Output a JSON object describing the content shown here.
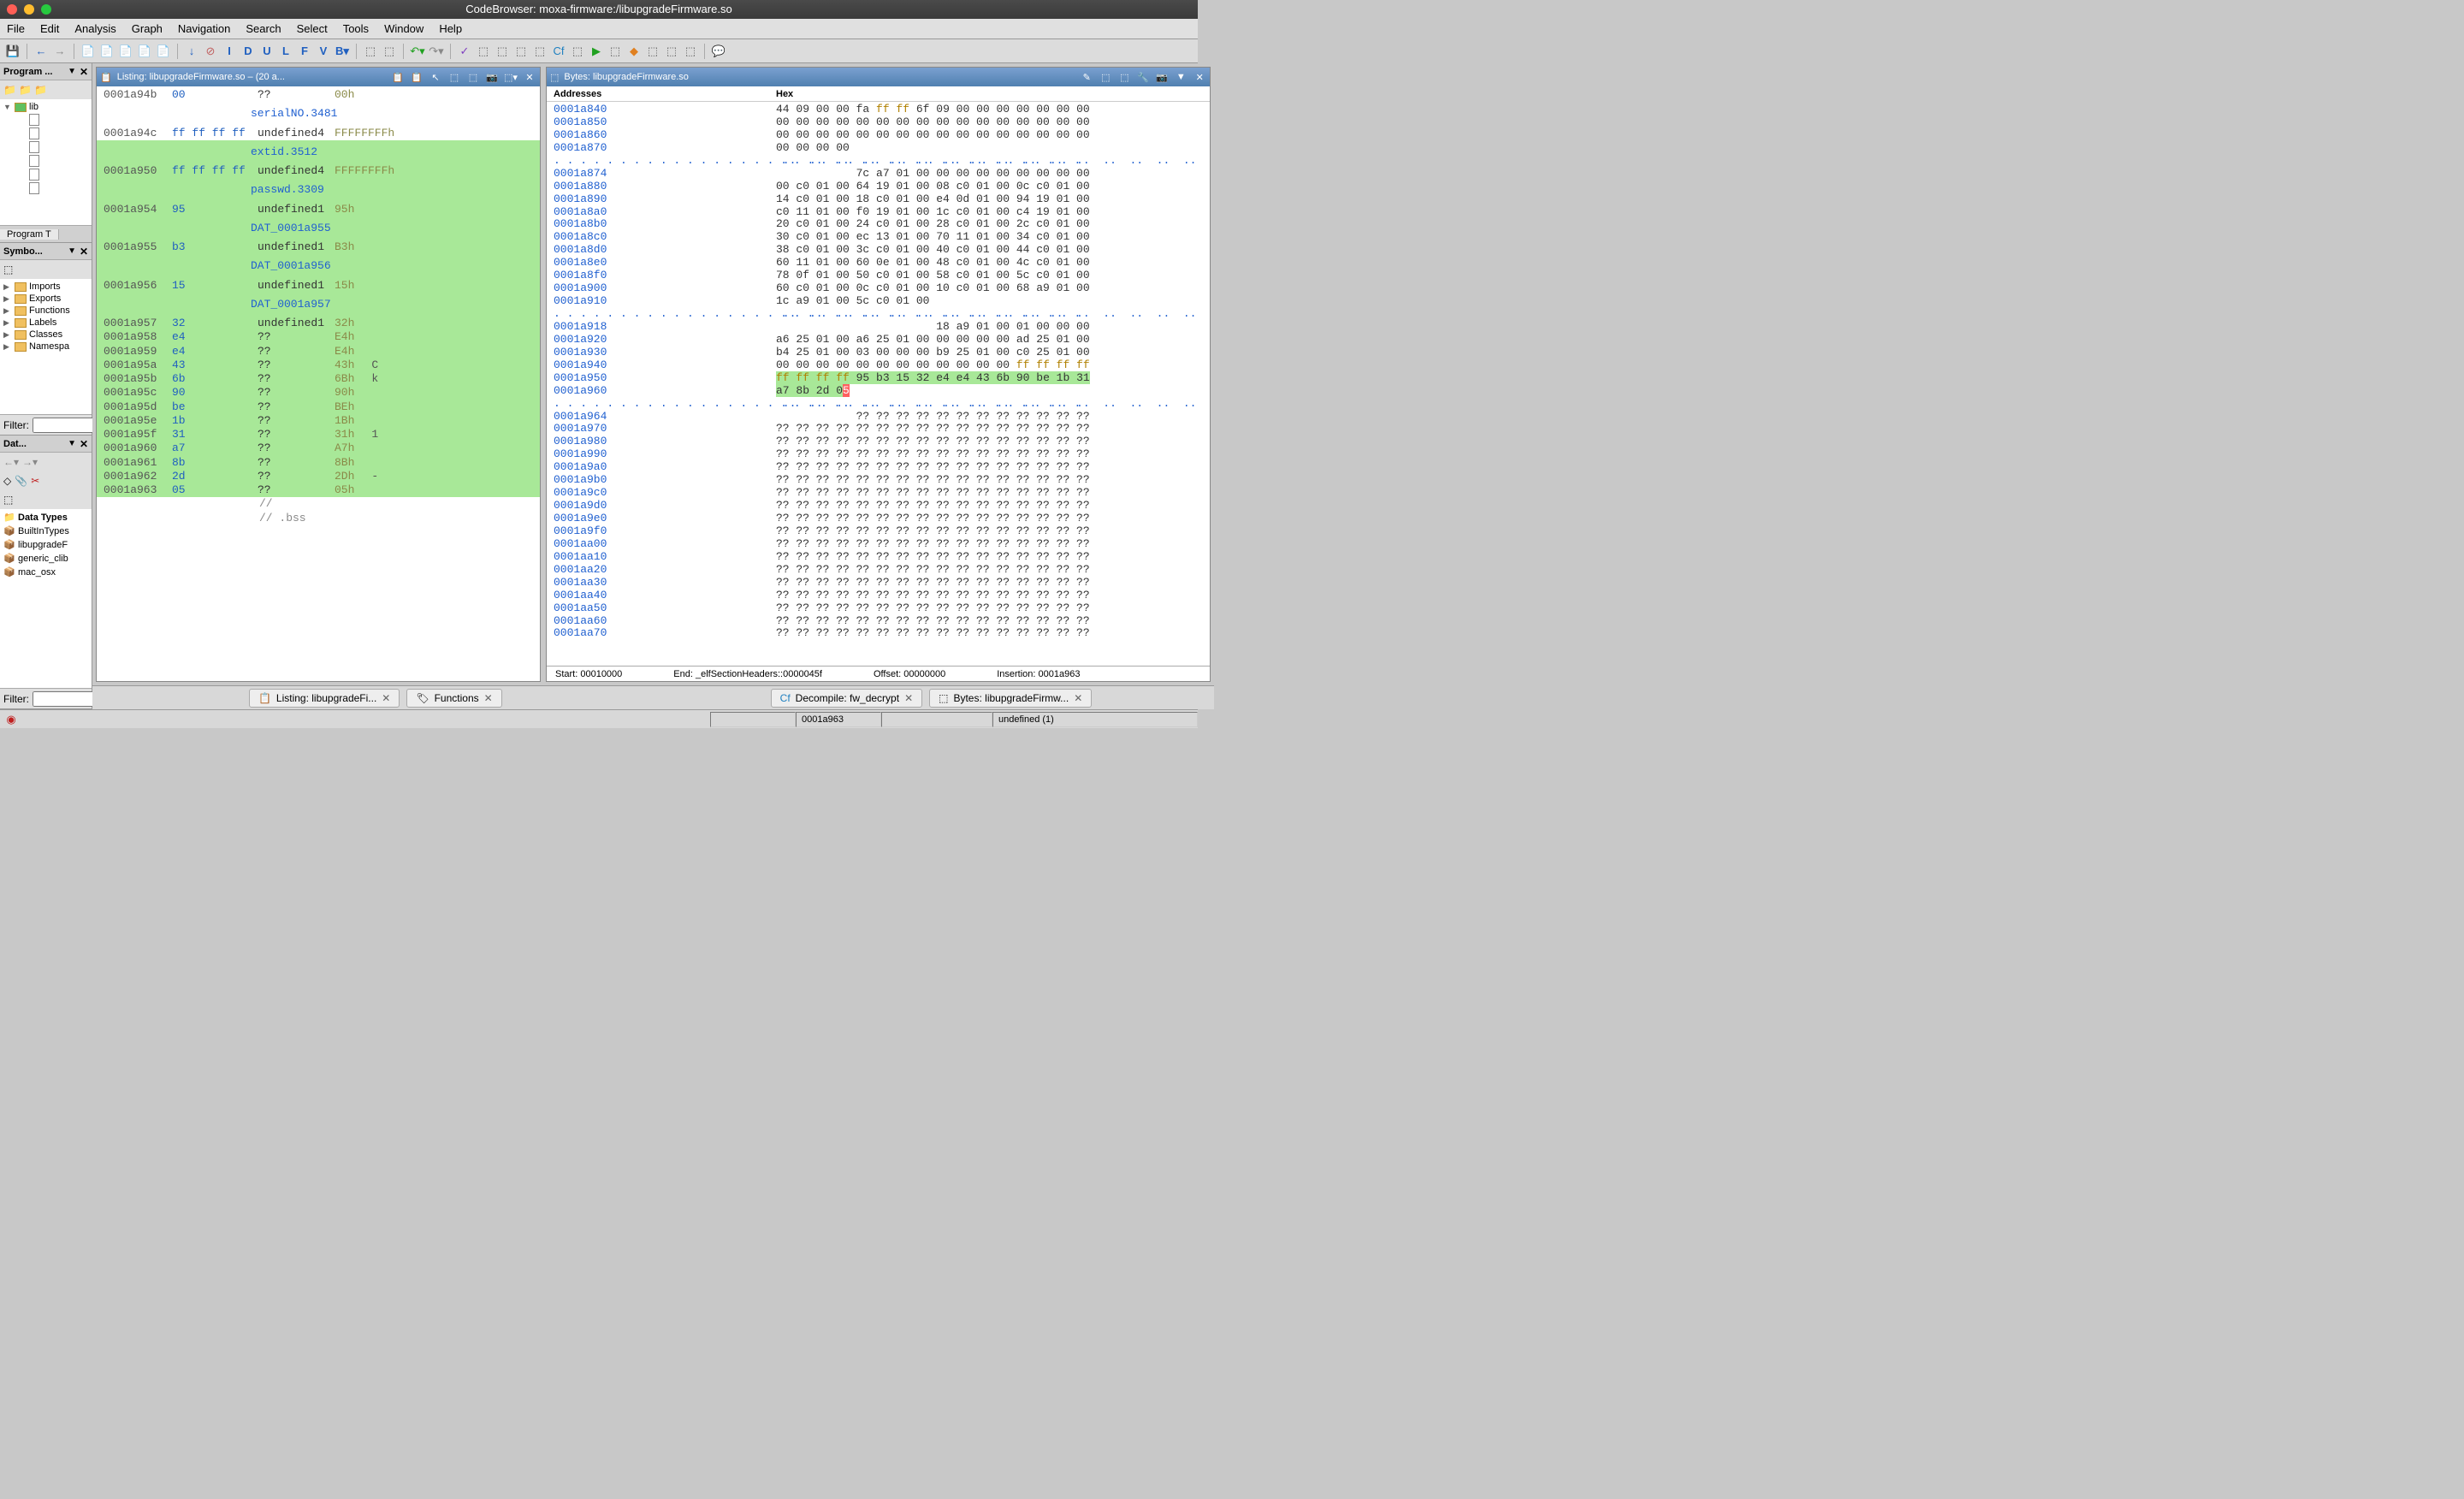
{
  "window": {
    "title": "CodeBrowser: moxa-firmware:/libupgradeFirmware.so"
  },
  "menubar": [
    "File",
    "Edit",
    "Analysis",
    "Graph",
    "Navigation",
    "Search",
    "Select",
    "Tools",
    "Window",
    "Help"
  ],
  "left": {
    "program_trees": {
      "title": "Program ...",
      "root": "lib",
      "tab": "Program T"
    },
    "symbol_tree": {
      "title": "Symbo...",
      "items": [
        "Imports",
        "Exports",
        "Functions",
        "Labels",
        "Classes",
        "Namespa"
      ],
      "filter_label": "Filter:"
    },
    "data_types": {
      "title": "Dat...",
      "heading": "Data Types",
      "items": [
        "BuiltInTypes",
        "libupgradeF",
        "generic_clib",
        "mac_osx"
      ],
      "filter_label": "Filter:"
    }
  },
  "listing": {
    "title": "Listing:  libupgradeFirmware.so – (20 a...",
    "rows": [
      {
        "addr": "0001a94b",
        "bytes": "00",
        "type": "??",
        "val": "00h",
        "hl": false
      },
      {
        "label": "serialNO.3481",
        "hl": false
      },
      {
        "addr": "0001a94c",
        "bytes": "ff ff ff ff",
        "type": "undefined4",
        "val": "FFFFFFFFh",
        "hl": false
      },
      {
        "label": "extid.3512",
        "hl": true
      },
      {
        "addr": "0001a950",
        "bytes": "ff ff ff ff",
        "type": "undefined4",
        "val": "FFFFFFFFh",
        "hl": true
      },
      {
        "label": "passwd.3309",
        "hl": true
      },
      {
        "addr": "0001a954",
        "bytes": "95",
        "type": "undefined1",
        "val": "95h",
        "hl": true
      },
      {
        "label": "DAT_0001a955",
        "hl": true
      },
      {
        "addr": "0001a955",
        "bytes": "b3",
        "type": "undefined1",
        "val": "B3h",
        "hl": true
      },
      {
        "label": "DAT_0001a956",
        "hl": true
      },
      {
        "addr": "0001a956",
        "bytes": "15",
        "type": "undefined1",
        "val": "15h",
        "hl": true
      },
      {
        "label": "DAT_0001a957",
        "hl": true
      },
      {
        "addr": "0001a957",
        "bytes": "32",
        "type": "undefined1",
        "val": "32h",
        "hl": true
      },
      {
        "addr": "0001a958",
        "bytes": "e4",
        "type": "??",
        "val": "E4h",
        "hl": true
      },
      {
        "addr": "0001a959",
        "bytes": "e4",
        "type": "??",
        "val": "E4h",
        "hl": true
      },
      {
        "addr": "0001a95a",
        "bytes": "43",
        "type": "??",
        "val": "43h",
        "comment": "C",
        "hl": true
      },
      {
        "addr": "0001a95b",
        "bytes": "6b",
        "type": "??",
        "val": "6Bh",
        "comment": "k",
        "hl": true
      },
      {
        "addr": "0001a95c",
        "bytes": "90",
        "type": "??",
        "val": "90h",
        "hl": true
      },
      {
        "addr": "0001a95d",
        "bytes": "be",
        "type": "??",
        "val": "BEh",
        "hl": true
      },
      {
        "addr": "0001a95e",
        "bytes": "1b",
        "type": "??",
        "val": "1Bh",
        "hl": true
      },
      {
        "addr": "0001a95f",
        "bytes": "31",
        "type": "??",
        "val": "31h",
        "comment": "1",
        "hl": true
      },
      {
        "addr": "0001a960",
        "bytes": "a7",
        "type": "??",
        "val": "A7h",
        "hl": true
      },
      {
        "addr": "0001a961",
        "bytes": "8b",
        "type": "??",
        "val": "8Bh",
        "hl": true
      },
      {
        "addr": "0001a962",
        "bytes": "2d",
        "type": "??",
        "val": "2Dh",
        "comment": "-",
        "hl": true
      },
      {
        "addr": "0001a963",
        "bytes": "05",
        "type": "??",
        "val": "05h",
        "hl": true,
        "arrow": true
      },
      {
        "comment_line": "//",
        "hl": false
      },
      {
        "comment_line": "// .bss",
        "hl": false
      }
    ]
  },
  "bytes_panel": {
    "title": "Bytes: libupgradeFirmware.so",
    "col_addr": "Addresses",
    "col_hex": "Hex",
    "rows": [
      {
        "addr": "0001a840",
        "hex": "44 09 00 00 fa ff ff 6f 09 00 00 00 00 00 00 00"
      },
      {
        "addr": "0001a850",
        "hex": "00 00 00 00 00 00 00 00 00 00 00 00 00 00 00 00"
      },
      {
        "addr": "0001a860",
        "hex": "00 00 00 00 00 00 00 00 00 00 00 00 00 00 00 00"
      },
      {
        "addr": "0001a870",
        "hex": "00 00 00 00"
      },
      {
        "dots": true
      },
      {
        "addr": "0001a874",
        "hex": "            7c a7 01 00 00 00 00 00 00 00 00 00"
      },
      {
        "addr": "0001a880",
        "hex": "00 c0 01 00 64 19 01 00 08 c0 01 00 0c c0 01 00"
      },
      {
        "addr": "0001a890",
        "hex": "14 c0 01 00 18 c0 01 00 e4 0d 01 00 94 19 01 00"
      },
      {
        "addr": "0001a8a0",
        "hex": "c0 11 01 00 f0 19 01 00 1c c0 01 00 c4 19 01 00"
      },
      {
        "addr": "0001a8b0",
        "hex": "20 c0 01 00 24 c0 01 00 28 c0 01 00 2c c0 01 00"
      },
      {
        "addr": "0001a8c0",
        "hex": "30 c0 01 00 ec 13 01 00 70 11 01 00 34 c0 01 00"
      },
      {
        "addr": "0001a8d0",
        "hex": "38 c0 01 00 3c c0 01 00 40 c0 01 00 44 c0 01 00"
      },
      {
        "addr": "0001a8e0",
        "hex": "60 11 01 00 60 0e 01 00 48 c0 01 00 4c c0 01 00"
      },
      {
        "addr": "0001a8f0",
        "hex": "78 0f 01 00 50 c0 01 00 58 c0 01 00 5c c0 01 00"
      },
      {
        "addr": "0001a900",
        "hex": "60 c0 01 00 0c c0 01 00 10 c0 01 00 68 a9 01 00"
      },
      {
        "addr": "0001a910",
        "hex": "1c a9 01 00 5c c0 01 00"
      },
      {
        "dots": true
      },
      {
        "addr": "0001a918",
        "hex": "                        18 a9 01 00 01 00 00 00"
      },
      {
        "addr": "0001a920",
        "hex": "a6 25 01 00 a6 25 01 00 00 00 00 00 ad 25 01 00"
      },
      {
        "addr": "0001a930",
        "hex": "b4 25 01 00 03 00 00 00 b9 25 01 00 c0 25 01 00"
      },
      {
        "addr": "0001a940",
        "hex": "00 00 00 00 00 00 00 00 00 00 00 00 ff ff ff ff",
        "ff_last4": true
      },
      {
        "addr": "0001a950",
        "hex": "ff ff ff ff 95 b3 15 32 e4 e4 43 6b 90 be 1b 31",
        "hl_all": true,
        "ff_first4": true
      },
      {
        "addr": "0001a960",
        "hex": "a7 8b 2d 05",
        "hl_all": true,
        "red_last": true
      },
      {
        "dots": true
      },
      {
        "addr": "0001a964",
        "hex": "            ?? ?? ?? ?? ?? ?? ?? ?? ?? ?? ?? ??"
      },
      {
        "addr": "0001a970",
        "hex": "?? ?? ?? ?? ?? ?? ?? ?? ?? ?? ?? ?? ?? ?? ?? ??"
      },
      {
        "addr": "0001a980",
        "hex": "?? ?? ?? ?? ?? ?? ?? ?? ?? ?? ?? ?? ?? ?? ?? ??"
      },
      {
        "addr": "0001a990",
        "hex": "?? ?? ?? ?? ?? ?? ?? ?? ?? ?? ?? ?? ?? ?? ?? ??"
      },
      {
        "addr": "0001a9a0",
        "hex": "?? ?? ?? ?? ?? ?? ?? ?? ?? ?? ?? ?? ?? ?? ?? ??"
      },
      {
        "addr": "0001a9b0",
        "hex": "?? ?? ?? ?? ?? ?? ?? ?? ?? ?? ?? ?? ?? ?? ?? ??"
      },
      {
        "addr": "0001a9c0",
        "hex": "?? ?? ?? ?? ?? ?? ?? ?? ?? ?? ?? ?? ?? ?? ?? ??"
      },
      {
        "addr": "0001a9d0",
        "hex": "?? ?? ?? ?? ?? ?? ?? ?? ?? ?? ?? ?? ?? ?? ?? ??"
      },
      {
        "addr": "0001a9e0",
        "hex": "?? ?? ?? ?? ?? ?? ?? ?? ?? ?? ?? ?? ?? ?? ?? ??"
      },
      {
        "addr": "0001a9f0",
        "hex": "?? ?? ?? ?? ?? ?? ?? ?? ?? ?? ?? ?? ?? ?? ?? ??"
      },
      {
        "addr": "0001aa00",
        "hex": "?? ?? ?? ?? ?? ?? ?? ?? ?? ?? ?? ?? ?? ?? ?? ??"
      },
      {
        "addr": "0001aa10",
        "hex": "?? ?? ?? ?? ?? ?? ?? ?? ?? ?? ?? ?? ?? ?? ?? ??"
      },
      {
        "addr": "0001aa20",
        "hex": "?? ?? ?? ?? ?? ?? ?? ?? ?? ?? ?? ?? ?? ?? ?? ??"
      },
      {
        "addr": "0001aa30",
        "hex": "?? ?? ?? ?? ?? ?? ?? ?? ?? ?? ?? ?? ?? ?? ?? ??"
      },
      {
        "addr": "0001aa40",
        "hex": "?? ?? ?? ?? ?? ?? ?? ?? ?? ?? ?? ?? ?? ?? ?? ??"
      },
      {
        "addr": "0001aa50",
        "hex": "?? ?? ?? ?? ?? ?? ?? ?? ?? ?? ?? ?? ?? ?? ?? ??"
      },
      {
        "addr": "0001aa60",
        "hex": "?? ?? ?? ?? ?? ?? ?? ?? ?? ?? ?? ?? ?? ?? ?? ??"
      },
      {
        "addr": "0001aa70",
        "hex": "?? ?? ?? ?? ?? ?? ?? ?? ?? ?? ?? ?? ?? ?? ?? ??"
      }
    ],
    "status": {
      "start": "Start: 00010000",
      "end": "End: _elfSectionHeaders::0000045f",
      "offset": "Offset: 00000000",
      "insertion": "Insertion: 0001a963"
    }
  },
  "bottom_tabs": {
    "left": [
      {
        "label": "Listing:  libupgradeFi..."
      },
      {
        "label": "Functions"
      }
    ],
    "right": [
      {
        "label": "Decompile: fw_decrypt"
      },
      {
        "label": "Bytes: libupgradeFirmw..."
      }
    ]
  },
  "statusbar": {
    "addr": "0001a963",
    "type": "undefined  (1)"
  }
}
